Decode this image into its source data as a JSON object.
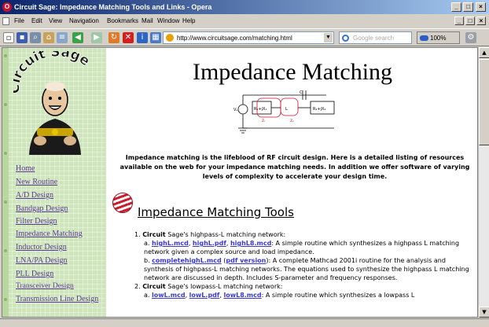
{
  "window": {
    "title": "Circuit Sage: Impedance Matching Tools and Links - Opera",
    "controls": [
      "_",
      "□",
      "×"
    ]
  },
  "menu": {
    "items": [
      "File",
      "Edit",
      "View",
      "Navigation",
      "Bookmarks",
      "Mail",
      "Window",
      "Help"
    ],
    "doc_controls": [
      "_",
      "□",
      "×"
    ]
  },
  "toolbar": {
    "address": "http://www.circuitsage.com/matching.html",
    "search_placeholder": "Google search",
    "zoom": "100%"
  },
  "sidebar": {
    "logo_text": "Circuit Sage",
    "links": [
      "Home",
      "New Routine",
      "A/D Design",
      "Bandgap Design",
      "Filter Design",
      "Impedance Matching",
      "Inductor Design",
      "LNA/PA Design",
      "PLL Design",
      "Transceiver Design",
      "Transmission Line Design"
    ]
  },
  "main": {
    "title": "Impedance Matching",
    "intro": "Impedance matching is the lifeblood of RF circuit design. Here is a detailed listing of resources available on the web for your impedance matching needs. In addition we offer software of varying levels of complexity to accelerate your design time.",
    "section_title": "Impedance Matching Tools",
    "items": [
      {
        "num": "1.",
        "circuit": "Circuit",
        "head_rest": " Sage's highpass-L matching network:",
        "a_label": "a.",
        "a_links": [
          "highL.mcd",
          "highL.pdf",
          "highL8.mcd"
        ],
        "a_text": ":    A simple routine which synthesizes a highpass L matching network given a complex source and load impedance.",
        "b_label": "b.",
        "b_link": "completehighL.mcd",
        "b_paren_link": "pdf version",
        "b_text": ":    A complete Mathcad 2001i routine for the analysis and synthesis of highpass-L matching networks. The equations used to synthesize the highpass L matching network are discussed in depth. Includes S-parameter and frequency responses."
      },
      {
        "num": "2.",
        "circuit": "Circuit",
        "head_rest": " Sage's lowpass-L matching network:",
        "a_label": "a.",
        "a_links": [
          "lowL.mcd",
          "lowL.pdf",
          "lowL8.mcd"
        ],
        "a_text": ":    A simple routine which synthesizes a lowpass L"
      }
    ]
  },
  "colors": {
    "sidebar_bg": "#cfe6bd",
    "nav_link": "#5a3b91",
    "doc_link": "#3a3ad0",
    "titlebar": "#0a246a"
  },
  "icons": [
    "opera-icon",
    "new-page-icon",
    "save-icon",
    "find-icon",
    "home-icon",
    "back-icon",
    "forward-icon",
    "reload-icon",
    "stop-icon",
    "info-icon",
    "panel-icon",
    "lock-icon",
    "search-icon",
    "zoom-icon"
  ]
}
